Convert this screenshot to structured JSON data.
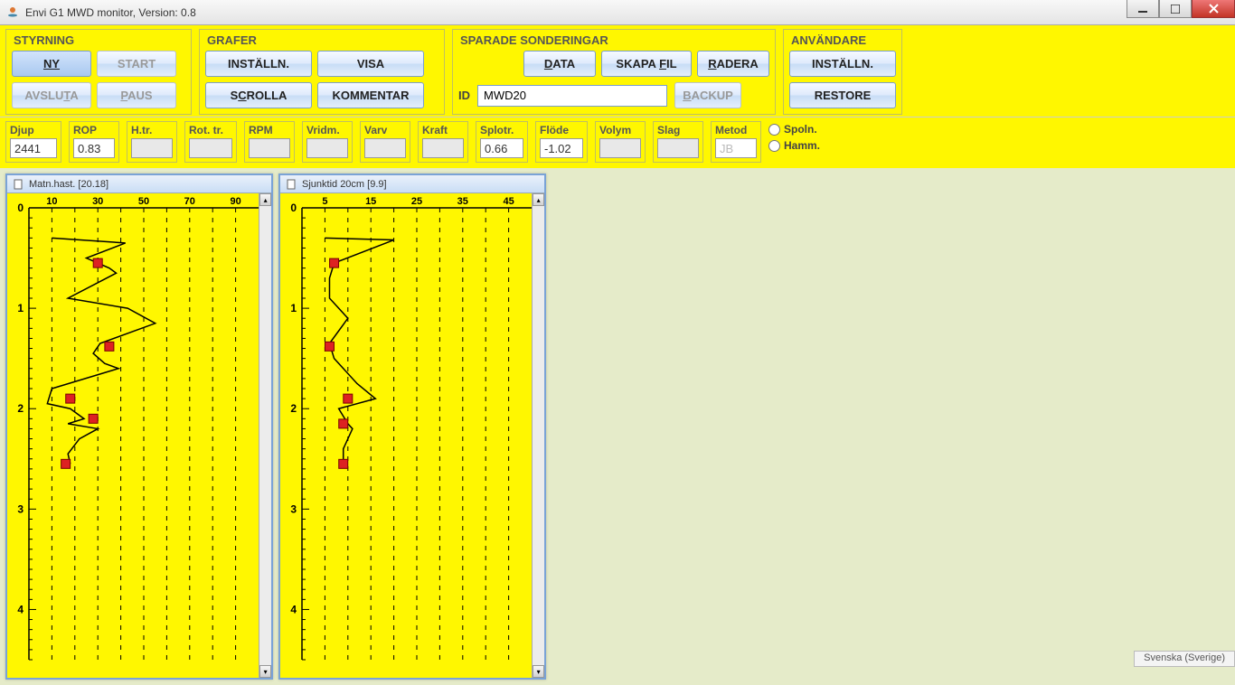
{
  "window": {
    "title": "Envi G1 MWD monitor,   Version: 0.8"
  },
  "groups": {
    "styrning": {
      "title": "STYRNING",
      "ny": "NY",
      "start": "START",
      "avsluta": "AVSLUTA",
      "paus": "PAUS"
    },
    "grafer": {
      "title": "GRAFER",
      "installn": "INSTÄLLN.",
      "visa": "VISA",
      "scrolla": "SCROLLA",
      "kommentar": "KOMMENTAR"
    },
    "sparade": {
      "title": "SPARADE SONDERINGAR",
      "data": "DATA",
      "skapafil": "SKAPA FIL",
      "radera": "RADERA",
      "backup": "BACKUP",
      "id_label": "ID",
      "id_value": "MWD20"
    },
    "anvandare": {
      "title": "ANVÄNDARE",
      "installn": "INSTÄLLN.",
      "restore": "RESTORE"
    }
  },
  "params": {
    "djup": {
      "label": "Djup",
      "value": "2441"
    },
    "rop": {
      "label": "ROP",
      "value": "0.83"
    },
    "htr": {
      "label": "H.tr.",
      "value": ""
    },
    "rottr": {
      "label": "Rot. tr.",
      "value": ""
    },
    "rpm": {
      "label": "RPM",
      "value": ""
    },
    "vridm": {
      "label": "Vridm.",
      "value": ""
    },
    "varv": {
      "label": "Varv",
      "value": ""
    },
    "kraft": {
      "label": "Kraft",
      "value": ""
    },
    "splotr": {
      "label": "Splotr.",
      "value": "0.66"
    },
    "flode": {
      "label": "Flöde",
      "value": "-1.02"
    },
    "volym": {
      "label": "Volym",
      "value": ""
    },
    "slag": {
      "label": "Slag",
      "value": ""
    },
    "metod": {
      "label": "Metod",
      "value": "JB"
    },
    "radio1": "Spoln.",
    "radio2": "Hamm."
  },
  "charts": {
    "c1": {
      "title": "Matn.hast.   [20.18]",
      "x_ticks": [
        "10",
        "30",
        "50",
        "70",
        "90"
      ]
    },
    "c2": {
      "title": "Sjunktid 20cm   [9.9]",
      "x_ticks": [
        "5",
        "15",
        "25",
        "35",
        "45"
      ]
    },
    "y_ticks": [
      "0",
      "1",
      "2",
      "3",
      "4"
    ]
  },
  "chart_data": [
    {
      "type": "line",
      "title": "Matn.hast. [20.18]",
      "xlabel": "",
      "ylabel": "Djup",
      "x_range": [
        0,
        100
      ],
      "y_range": [
        0,
        4.5
      ],
      "x_ticks": [
        10,
        30,
        50,
        70,
        90
      ],
      "y_ticks": [
        0,
        1,
        2,
        3,
        4
      ],
      "series": [
        {
          "name": "matn.hast",
          "points": [
            [
              10,
              0.3
            ],
            [
              42,
              0.35
            ],
            [
              25,
              0.5
            ],
            [
              30,
              0.55
            ],
            [
              35,
              0.6
            ],
            [
              38,
              0.65
            ],
            [
              17,
              0.9
            ],
            [
              43,
              1.0
            ],
            [
              55,
              1.15
            ],
            [
              31,
              1.35
            ],
            [
              28,
              1.45
            ],
            [
              33,
              1.55
            ],
            [
              39,
              1.6
            ],
            [
              10,
              1.8
            ],
            [
              8,
              1.95
            ],
            [
              18,
              2.0
            ],
            [
              24,
              2.1
            ],
            [
              17,
              2.15
            ],
            [
              30,
              2.2
            ],
            [
              22,
              2.3
            ],
            [
              17,
              2.45
            ],
            [
              18,
              2.55
            ]
          ]
        }
      ],
      "markers": [
        {
          "x": 30,
          "y": 0.55
        },
        {
          "x": 35,
          "y": 1.38
        },
        {
          "x": 18,
          "y": 1.9
        },
        {
          "x": 28,
          "y": 2.1
        },
        {
          "x": 16,
          "y": 2.55
        }
      ]
    },
    {
      "type": "line",
      "title": "Sjunktid 20cm [9.9]",
      "xlabel": "",
      "ylabel": "Djup",
      "x_range": [
        0,
        50
      ],
      "y_range": [
        0,
        4.5
      ],
      "x_ticks": [
        5,
        15,
        25,
        35,
        45
      ],
      "y_ticks": [
        0,
        1,
        2,
        3,
        4
      ],
      "series": [
        {
          "name": "sjunktid",
          "points": [
            [
              5,
              0.3
            ],
            [
              20,
              0.32
            ],
            [
              7,
              0.55
            ],
            [
              6,
              0.7
            ],
            [
              6,
              0.9
            ],
            [
              10,
              1.1
            ],
            [
              6,
              1.35
            ],
            [
              7,
              1.5
            ],
            [
              12,
              1.75
            ],
            [
              16,
              1.9
            ],
            [
              8,
              2.0
            ],
            [
              10,
              2.15
            ],
            [
              11,
              2.2
            ],
            [
              9,
              2.4
            ],
            [
              9,
              2.55
            ]
          ]
        }
      ],
      "markers": [
        {
          "x": 7,
          "y": 0.55
        },
        {
          "x": 6,
          "y": 1.38
        },
        {
          "x": 10,
          "y": 1.9
        },
        {
          "x": 9,
          "y": 2.15
        },
        {
          "x": 9,
          "y": 2.55
        }
      ]
    }
  ],
  "status": "Svenska (Sverige)"
}
